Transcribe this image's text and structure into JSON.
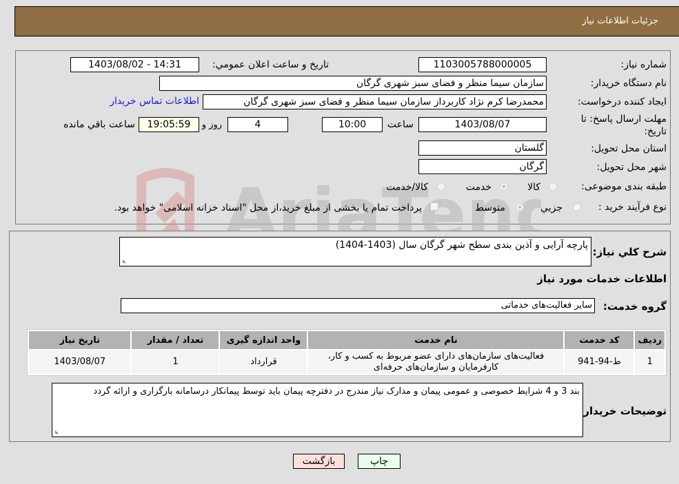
{
  "header": {
    "title": "جزئیات اطلاعات نیاز"
  },
  "form": {
    "need_number": {
      "label": "شماره نیاز:",
      "value": "1103005788000005"
    },
    "announce": {
      "label": "تاریخ و ساعت اعلان عمومي:",
      "value": "1403/08/02 - 14:31"
    },
    "buyer_org": {
      "label": "نام دستگاه خریدار:",
      "value": "سازمان سیما  منظر و فضای سبز شهری گرگان"
    },
    "creator": {
      "label": "ایجاد کننده درخواست:",
      "value": "محمدرضا کرم نژاد کاربرداز سازمان سیما  منظر و فضای سبز شهری گرگان",
      "contact_link": "اطلاعات تماس خریدار"
    },
    "deadline": {
      "label_line1": "مهلت ارسال پاسخ: تا",
      "label_line2": "تاریخ:",
      "date": "1403/08/07",
      "time_label": "ساعت",
      "time": "10:00",
      "days": "4",
      "days_label": "روز و",
      "remaining": "19:05:59",
      "remaining_label": "ساعت باقي مانده"
    },
    "province": {
      "label": "استان محل تحویل:",
      "value": "گلستان"
    },
    "city": {
      "label": "شهر محل تحویل:",
      "value": "گرگان"
    },
    "category": {
      "label": "طبقه بندی موضوعی:",
      "options": [
        {
          "label": "کالا",
          "checked": false
        },
        {
          "label": "خدمت",
          "checked": true
        },
        {
          "label": "کالا/خدمت",
          "checked": false
        }
      ]
    },
    "process": {
      "label": "نوع فرآیند خرید :",
      "options": [
        {
          "label": "جزيي",
          "checked": false
        },
        {
          "label": "متوسط",
          "checked": true
        }
      ],
      "treasury_note": "پرداخت تمام یا بخشی از مبلغ خرید،از محل \"اسناد خزانه اسلامی\" خواهد بود."
    }
  },
  "details": {
    "summary_label": "شرح کلي نياز:",
    "summary_value": "پارچه آرایی و آذین بندی سطح شهر گرگان سال (1403-1404)",
    "services_title": "اطلاعات خدمات مورد نیاز",
    "service_group_label": "گروه خدمت:",
    "service_group_value": "سایر فعالیت‌های خدماتی",
    "table": {
      "headers": [
        "ردیف",
        "کد خدمت",
        "نام خدمت",
        "واحد اندازه گیری",
        "تعداد / مقدار",
        "تاریخ نیاز"
      ],
      "rows": [
        [
          "1",
          "ط-94-941",
          "فعالیت‌های سازمان‌های دارای عضو مربوط به کسب و کار، کارفرمایان و سازمان‌های حرفه‌ای",
          "قرارداد",
          "1",
          "1403/08/07"
        ]
      ]
    },
    "buyer_notes_label": "توضیحات خریدار:",
    "buyer_notes_value": "بند 3 و 4 شرایط خصوصی و عمومی پیمان و مدارک نیاز مندرج در دفترچه پیمان باید توسط پیمانکار درسامانه بارگزاری و ارائه گردد"
  },
  "buttons": {
    "back": "بازگشت",
    "print": "چاپ"
  },
  "watermark": {
    "text": "AriaTender.neT"
  },
  "colors": {
    "header_bg": "#8e6e42",
    "back_btn_bg": "#fde0de",
    "print_btn_bg": "#eaffea",
    "link": "#1a1ad6"
  }
}
